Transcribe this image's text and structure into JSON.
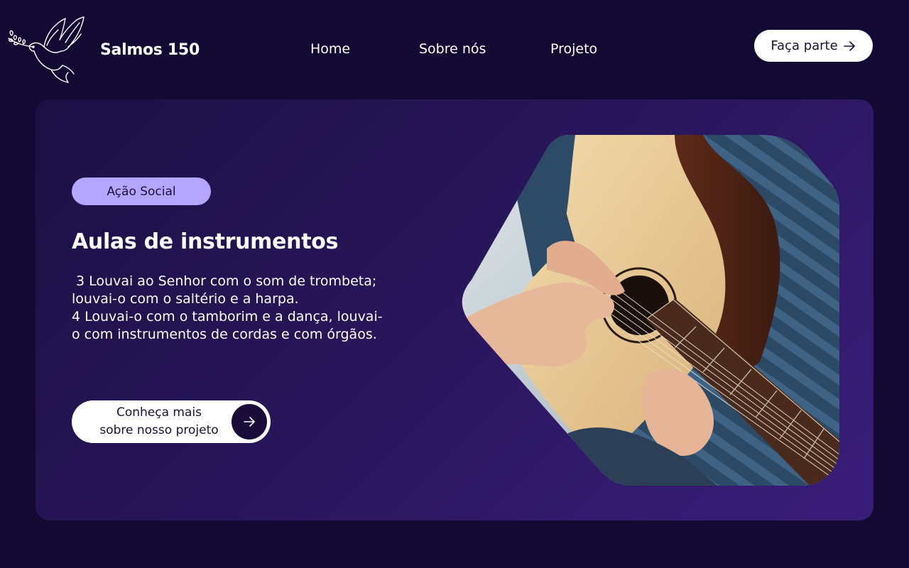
{
  "brand": {
    "name": "Salmos 150",
    "logo_icon": "dove-with-olive-branch-icon"
  },
  "nav": {
    "items": [
      {
        "label": "Home"
      },
      {
        "label": "Sobre nós"
      },
      {
        "label": "Projeto"
      }
    ]
  },
  "header": {
    "cta_label": "Faça parte",
    "cta_icon": "arrow-right-icon"
  },
  "hero": {
    "tag": "Ação Social",
    "title": "Aulas de instrumentos",
    "description_lines": [
      " 3 Louvai ao Senhor com o som de trombeta; louvai-o com o saltério e a harpa.",
      "4 Louvai-o com o tamborim e a dança, louvai-o com instrumentos de cordas e com órgãos."
    ],
    "button": {
      "line1": "Conheça mais",
      "line2": "sobre nosso projeto",
      "icon": "arrow-right-icon"
    },
    "image": "guitar-lesson-photo"
  },
  "colors": {
    "background": "#130a33",
    "card_start": "#1b1044",
    "card_end": "#3a1d7a",
    "tag_bg": "#b4a6ff",
    "button_bg": "#ffffff",
    "accent_dark": "#1a0d3a"
  }
}
